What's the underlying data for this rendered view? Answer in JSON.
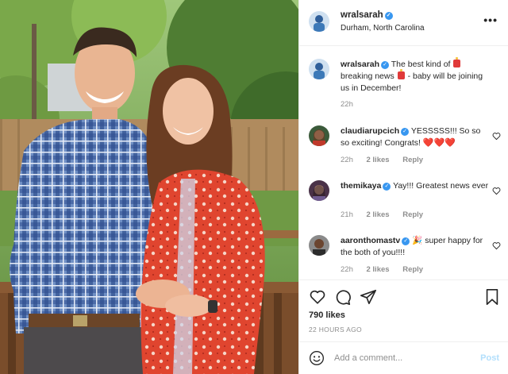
{
  "header": {
    "username": "wralsarah",
    "location": "Durham, North Carolina",
    "more_label": "•••"
  },
  "comments": [
    {
      "username": "wralsarah",
      "text_1": "The best kind of",
      "text_2": "breaking news",
      "text_3": "- baby will be joining us in December!",
      "time": "22h",
      "likes": "",
      "reply": ""
    },
    {
      "username": "claudiarupcich",
      "text": "YESSSSS!!! So so so exciting! Congrats!",
      "hearts": "❤️❤️❤️",
      "time": "22h",
      "likes": "2 likes",
      "reply": "Reply"
    },
    {
      "username": "themikaya",
      "text": "Yay!!! Greatest news ever",
      "time": "21h",
      "likes": "2 likes",
      "reply": "Reply"
    },
    {
      "username": "aaronthomastv",
      "text_emoji": "🎉",
      "text": "super happy for the both of you!!!!",
      "time": "22h",
      "likes": "2 likes",
      "reply": "Reply"
    }
  ],
  "actions": {
    "likes": "790 likes",
    "posted_ago": "22 HOURS AGO"
  },
  "add_comment": {
    "placeholder": "Add a comment...",
    "post_label": "Post"
  },
  "icons": {
    "heart": "heart-icon",
    "comment": "comment-icon",
    "share": "share-icon",
    "bookmark": "bookmark-icon",
    "emoji": "smiley-icon",
    "verified": "verified-badge-icon"
  },
  "colors": {
    "verified": "#3897f0",
    "post_disabled": "#b2dffc",
    "muted": "#8e8e8e"
  }
}
